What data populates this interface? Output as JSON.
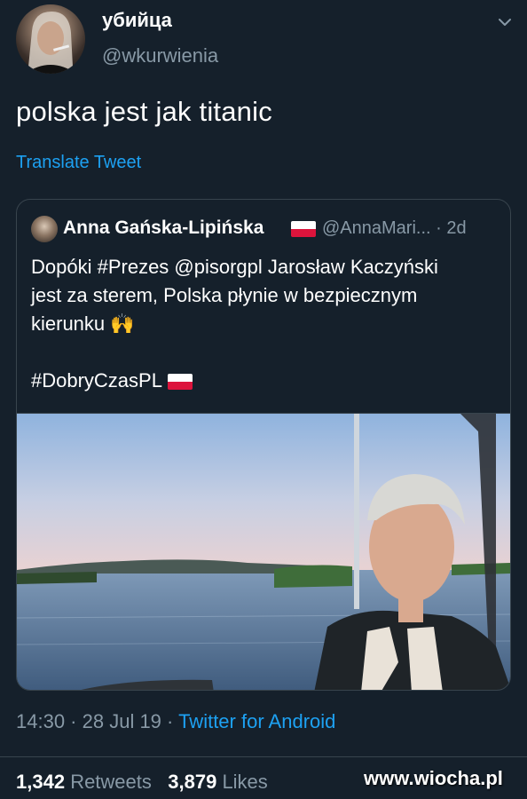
{
  "author": {
    "display_name": "убийца",
    "handle": "@wkurwienia"
  },
  "tweet": {
    "text": "polska jest jak titanic",
    "translate_label": "Translate Tweet"
  },
  "quoted": {
    "name": "Anna Gańska-Lipińska",
    "handle": "@AnnaMari...",
    "time": "· 2d",
    "lines": [
      "Dopóki #Prezes @pisorgpl Jarosław Kaczyński",
      "jest za sterem, Polska płynie w bezpiecznym",
      "kierunku 🙌"
    ],
    "hashtag": "#DobryCzasPL"
  },
  "meta": {
    "time": "14:30",
    "sep1": " · ",
    "date": "28 Jul 19",
    "sep2": " · ",
    "source": "Twitter for Android"
  },
  "stats": {
    "retweets": "1,342",
    "retweets_label": "Retweets",
    "likes": "3,879",
    "likes_label": "Likes"
  },
  "watermark": "www.wiocha.pl",
  "colors": {
    "background": "#15202b",
    "accent": "#1da1f2",
    "muted": "#8899a6",
    "border": "#38444d"
  },
  "icons": {
    "caret": "chevron-down-icon",
    "flag": "poland-flag-icon"
  }
}
